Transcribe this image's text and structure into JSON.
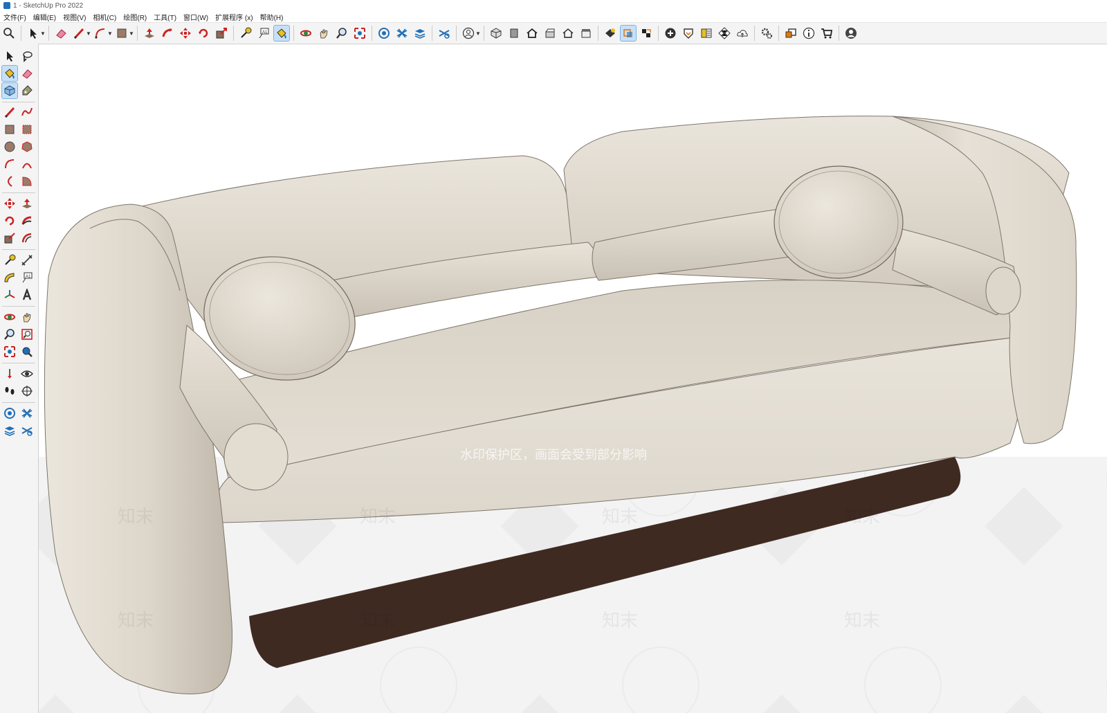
{
  "window": {
    "title": "1 - SketchUp Pro 2022"
  },
  "menu": [
    "文件(F)",
    "编辑(E)",
    "视图(V)",
    "相机(C)",
    "绘图(R)",
    "工具(T)",
    "窗口(W)",
    "扩展程序 (x)",
    "帮助(H)"
  ],
  "toolbar": {
    "groups": [
      [
        "zoom-icon"
      ],
      [
        "select-arrow-icon"
      ],
      [
        "eraser-icon",
        "pencil-icon",
        "arc-icon",
        "rectangle-icon"
      ],
      [
        "push-pull-icon",
        "follow-me-icon",
        "move-icon",
        "rotate-icon",
        "scale-icon"
      ],
      [
        "tape-measure-icon",
        "text-icon",
        "paint-bucket-icon"
      ],
      [
        "orbit-icon",
        "pan-icon",
        "zoom-tool-icon",
        "zoom-extents-icon"
      ],
      [
        "sandbox-icon",
        "warehouse-icon",
        "layers-icon"
      ],
      [
        "scenes-icon"
      ],
      [
        "account-icon"
      ],
      [
        "iso-view-icon",
        "top-view-icon",
        "front-view-icon",
        "right-view-icon",
        "back-view-icon",
        "left-view-icon"
      ],
      [
        "shadow-icon",
        "section-plane-icon",
        "section-display-icon"
      ],
      [
        "add-location-icon",
        "solid-tools-icon",
        "styles-icon",
        "texture-icon",
        "cloud-icon"
      ],
      [
        "preferences-icon"
      ],
      [
        "component-icon",
        "info-icon",
        "cart-icon",
        "user-icon"
      ]
    ],
    "active": [
      "paint-bucket-icon",
      "section-plane-icon"
    ]
  },
  "left_tools": {
    "active": [
      "paint-bucket-tool",
      "component-tool"
    ]
  },
  "watermark": {
    "notice": "水印保护区，画面会受到部分影响",
    "brand": "知末"
  },
  "colors": {
    "fabric": "#e6e0d6",
    "fabric_shadow": "#c7bfb2",
    "base_wood": "#3f2a22",
    "toolbar_bg": "#f4f4f4",
    "active_tool": "#c8e0f7"
  }
}
